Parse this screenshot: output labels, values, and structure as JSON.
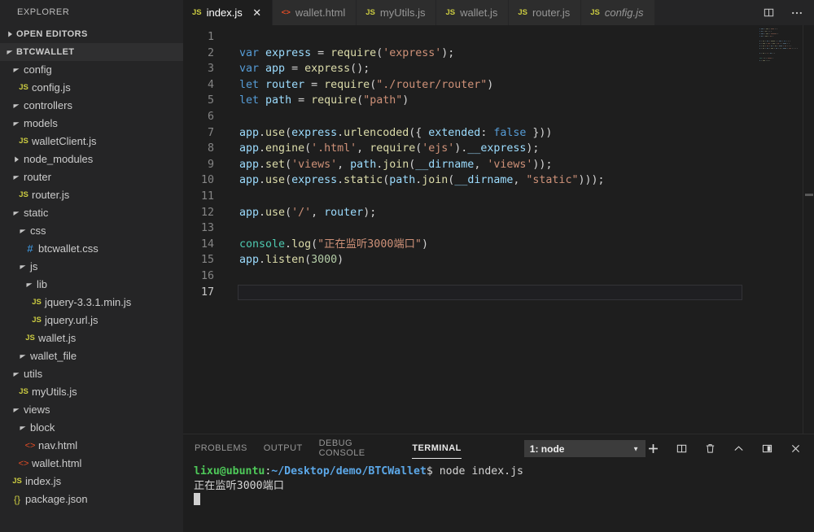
{
  "sidebar": {
    "title": "EXPLORER",
    "sections": [
      {
        "label": "OPEN EDITORS",
        "expanded": false
      },
      {
        "label": "BTCWALLET",
        "expanded": true
      }
    ],
    "tree": [
      {
        "label": "config",
        "type": "folder",
        "depth": 1,
        "expanded": true
      },
      {
        "label": "config.js",
        "type": "js",
        "depth": 2
      },
      {
        "label": "controllers",
        "type": "folder",
        "depth": 1,
        "expanded": true
      },
      {
        "label": "models",
        "type": "folder",
        "depth": 1,
        "expanded": true
      },
      {
        "label": "walletClient.js",
        "type": "js",
        "depth": 2
      },
      {
        "label": "node_modules",
        "type": "folder",
        "depth": 1,
        "expanded": false
      },
      {
        "label": "router",
        "type": "folder",
        "depth": 1,
        "expanded": true
      },
      {
        "label": "router.js",
        "type": "js",
        "depth": 2
      },
      {
        "label": "static",
        "type": "folder",
        "depth": 1,
        "expanded": true
      },
      {
        "label": "css",
        "type": "folder",
        "depth": 2,
        "expanded": true
      },
      {
        "label": "btcwallet.css",
        "type": "css",
        "depth": 3
      },
      {
        "label": "js",
        "type": "folder",
        "depth": 2,
        "expanded": true
      },
      {
        "label": "lib",
        "type": "folder",
        "depth": 3,
        "expanded": true
      },
      {
        "label": "jquery-3.3.1.min.js",
        "type": "js",
        "depth": 4
      },
      {
        "label": "jquery.url.js",
        "type": "js",
        "depth": 4
      },
      {
        "label": "wallet.js",
        "type": "js",
        "depth": 3
      },
      {
        "label": "wallet_file",
        "type": "folder",
        "depth": 2,
        "expanded": true
      },
      {
        "label": "utils",
        "type": "folder",
        "depth": 1,
        "expanded": true
      },
      {
        "label": "myUtils.js",
        "type": "js",
        "depth": 2
      },
      {
        "label": "views",
        "type": "folder",
        "depth": 1,
        "expanded": true
      },
      {
        "label": "block",
        "type": "folder",
        "depth": 2,
        "expanded": true
      },
      {
        "label": "nav.html",
        "type": "html",
        "depth": 3
      },
      {
        "label": "wallet.html",
        "type": "html",
        "depth": 2
      },
      {
        "label": "index.js",
        "type": "js",
        "depth": 1
      },
      {
        "label": "package.json",
        "type": "json",
        "depth": 1
      }
    ]
  },
  "tabs": [
    {
      "label": "index.js",
      "icon": "JS",
      "type": "js",
      "active": true,
      "italic": false,
      "closable": true
    },
    {
      "label": "wallet.html",
      "icon": "<>",
      "type": "html",
      "active": false,
      "italic": false,
      "closable": false
    },
    {
      "label": "myUtils.js",
      "icon": "JS",
      "type": "js",
      "active": false,
      "italic": false,
      "closable": false
    },
    {
      "label": "wallet.js",
      "icon": "JS",
      "type": "js",
      "active": false,
      "italic": false,
      "closable": false
    },
    {
      "label": "router.js",
      "icon": "JS",
      "type": "js",
      "active": false,
      "italic": false,
      "closable": false
    },
    {
      "label": "config.js",
      "icon": "JS",
      "type": "js",
      "active": false,
      "italic": true,
      "closable": false
    }
  ],
  "tabbar_actions": [
    {
      "name": "split-editor-icon",
      "title": "Split Editor"
    },
    {
      "name": "more-actions-icon",
      "title": "More Actions..."
    }
  ],
  "editor": {
    "language": "javascript",
    "current_line": 17,
    "line_numbers": [
      "1",
      "2",
      "3",
      "4",
      "5",
      "6",
      "7",
      "8",
      "9",
      "10",
      "11",
      "12",
      "13",
      "14",
      "15",
      "16",
      "17"
    ],
    "code_plain": [
      "",
      "var express = require('express');",
      "var app = express();",
      "let router = require(\"./router/router\")",
      "let path = require(\"path\")",
      "",
      "app.use(express.urlencoded({ extended: false }))",
      "app.engine('.html', require('ejs').__express);",
      "app.set('views', path.join(__dirname, 'views'));",
      "app.use(express.static(path.join(__dirname, \"static\")));",
      "",
      "app.use('/', router);",
      "",
      "console.log(\"正在监听3000端口\")",
      "app.listen(3000)",
      "",
      ""
    ]
  },
  "panel": {
    "tabs": [
      {
        "label": "PROBLEMS",
        "active": false
      },
      {
        "label": "OUTPUT",
        "active": false
      },
      {
        "label": "DEBUG CONSOLE",
        "active": false
      },
      {
        "label": "TERMINAL",
        "active": true
      }
    ],
    "terminal_select": {
      "value": "1: node",
      "caret": "▼"
    },
    "actions": [
      {
        "name": "new-terminal-icon",
        "title": "New Terminal"
      },
      {
        "name": "split-terminal-icon",
        "title": "Split Terminal"
      },
      {
        "name": "kill-terminal-icon",
        "title": "Kill Terminal"
      },
      {
        "name": "chevron-up-icon",
        "title": "Maximize Panel Size"
      },
      {
        "name": "maximize-panel-icon",
        "title": "Maximize Panel"
      },
      {
        "name": "close-panel-icon",
        "title": "Close Panel"
      }
    ],
    "terminal": {
      "user": "lixu@ubuntu",
      "colon": ":",
      "path": "~/Desktop/demo/BTCWallet",
      "command": "$ node index.js",
      "output": "正在监听3000端口"
    }
  },
  "colors": {
    "editor_bg": "#1e1e1e",
    "sidebar_bg": "#252526",
    "tab_inactive_bg": "#2d2d2d",
    "accent_js": "#cbcb41",
    "accent_html": "#e44d26",
    "accent_css": "#42a5f5",
    "terminal_green": "#4ec959",
    "terminal_blue": "#5ca8e8"
  }
}
